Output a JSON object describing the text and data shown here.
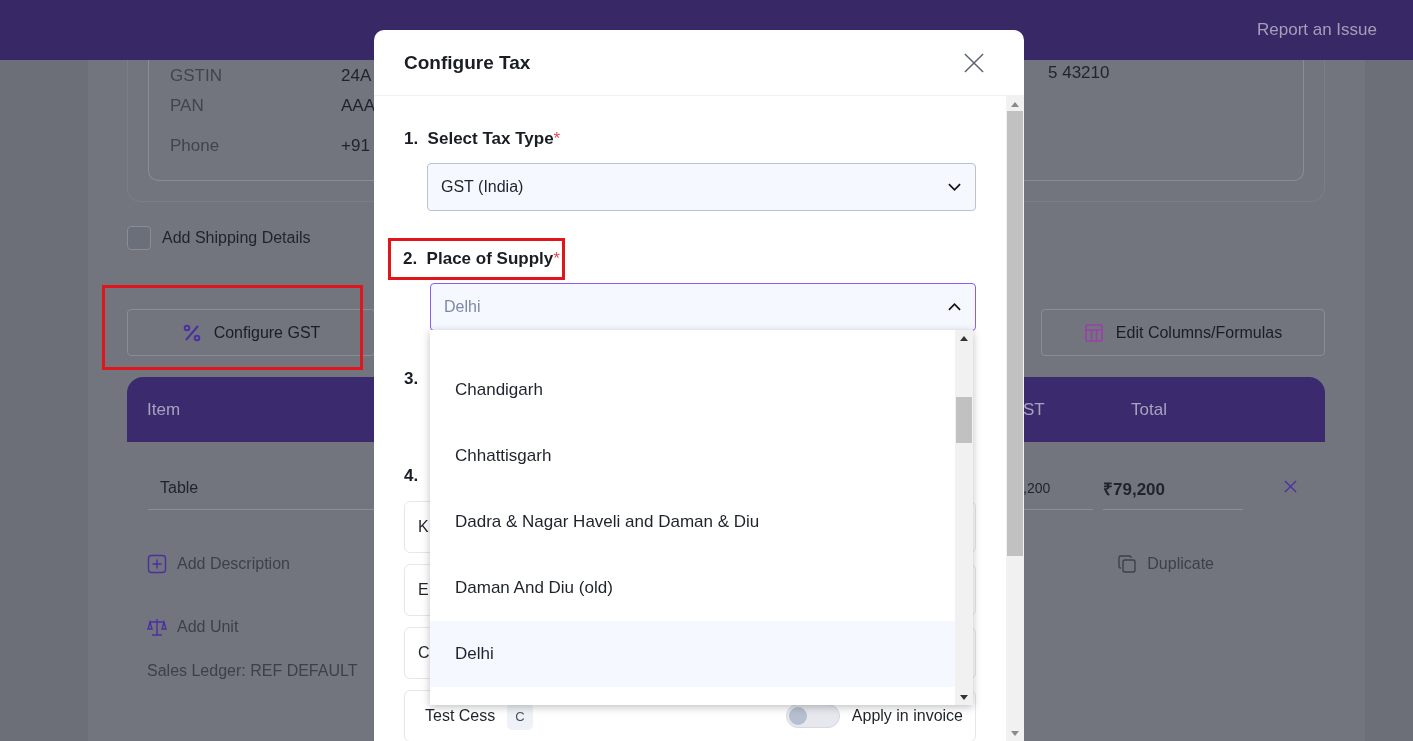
{
  "header": {
    "link": "Report an Issue"
  },
  "details": {
    "rows": [
      {
        "label": "GSTIN",
        "value": "24A",
        "extra": "5 43210"
      },
      {
        "label": "PAN",
        "value": "AAA"
      },
      {
        "label": "Phone",
        "value": "+91"
      }
    ]
  },
  "shipping": {
    "label": "Add Shipping Details",
    "checked": false
  },
  "configure_button": {
    "label": "Configure GST",
    "highlighted": true
  },
  "edit_columns_button": {
    "label": "Edit Columns/Formulas"
  },
  "table": {
    "columns": [
      "Item",
      "ST",
      "Total"
    ],
    "row": {
      "item": "Table",
      "column_2": ",200",
      "total": "₹79,200"
    },
    "add_description": "Add Description",
    "duplicate": "Duplicate",
    "add_unit": "Add Unit",
    "sales_ledger": "Sales Ledger: REF DEFAULT"
  },
  "modal": {
    "title": "Configure Tax",
    "steps": [
      {
        "kind": "select",
        "number": "1.",
        "label": "Select Tax Type",
        "required_mark": "*",
        "highlighted": false,
        "value": "GST (India)",
        "open": false
      },
      {
        "kind": "select",
        "number": "2.",
        "label": "Place of Supply",
        "required_mark": "*",
        "highlighted": true,
        "value": "Delhi",
        "open": true,
        "options": [
          {
            "label": "Chandigarh",
            "selected": false
          },
          {
            "label": "Chhattisgarh",
            "selected": false
          },
          {
            "label": "Dadra & Nagar Haveli and Daman & Diu",
            "selected": false
          },
          {
            "label": "Daman And Diu (old)",
            "selected": false
          },
          {
            "label": "Delhi",
            "selected": true
          }
        ]
      },
      {
        "kind": "blank",
        "number": "3."
      },
      {
        "kind": "list",
        "number": "4.",
        "rows": [
          {
            "name": "K"
          },
          {
            "name": "E"
          },
          {
            "name": "C"
          },
          {
            "name": "Test Cess",
            "badge": "C",
            "toggle": {
              "label": "Apply in invoice",
              "on": false
            }
          }
        ]
      }
    ]
  }
}
